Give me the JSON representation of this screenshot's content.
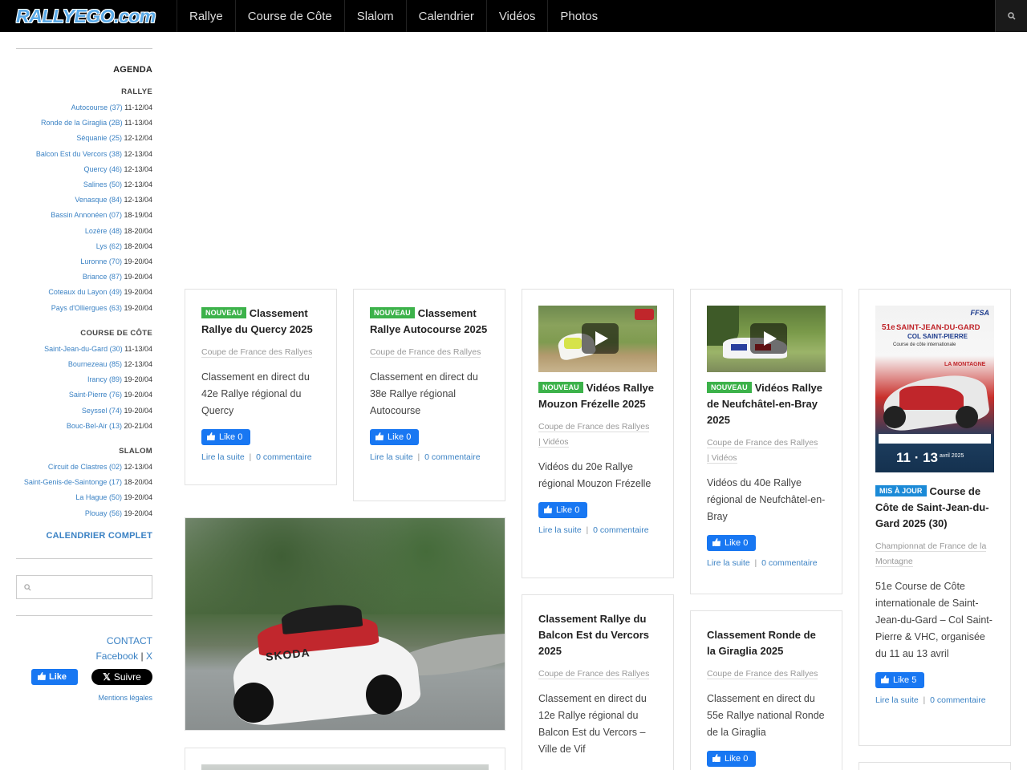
{
  "site": {
    "logo": "RALLYEGO.com"
  },
  "nav": [
    "Rallye",
    "Course de Côte",
    "Slalom",
    "Calendrier",
    "Vidéos",
    "Photos"
  ],
  "sidebar": {
    "agenda_title": "AGENDA",
    "categories": [
      {
        "title": "RALLYE",
        "events": [
          {
            "name": "Autocourse (37)",
            "dates": "11-12/04"
          },
          {
            "name": "Ronde de la Giraglia (2B)",
            "dates": "11-13/04"
          },
          {
            "name": "Séquanie (25)",
            "dates": "12-12/04"
          },
          {
            "name": "Balcon Est du Vercors (38)",
            "dates": "12-13/04"
          },
          {
            "name": "Quercy (46)",
            "dates": "12-13/04"
          },
          {
            "name": "Salines (50)",
            "dates": "12-13/04"
          },
          {
            "name": "Venasque (84)",
            "dates": "12-13/04"
          },
          {
            "name": "Bassin Annonéen (07)",
            "dates": "18-19/04"
          },
          {
            "name": "Lozère (48)",
            "dates": "18-20/04"
          },
          {
            "name": "Lys (62)",
            "dates": "18-20/04"
          },
          {
            "name": "Luronne (70)",
            "dates": "19-20/04"
          },
          {
            "name": "Briance (87)",
            "dates": "19-20/04"
          },
          {
            "name": "Coteaux du Layon (49)",
            "dates": "19-20/04"
          },
          {
            "name": "Pays d'Olliergues (63)",
            "dates": "19-20/04"
          }
        ]
      },
      {
        "title": "COURSE DE CÔTE",
        "events": [
          {
            "name": "Saint-Jean-du-Gard (30)",
            "dates": "11-13/04"
          },
          {
            "name": "Bournezeau (85)",
            "dates": "12-13/04"
          },
          {
            "name": "Irancy (89)",
            "dates": "19-20/04"
          },
          {
            "name": "Saint-Pierre (76)",
            "dates": "19-20/04"
          },
          {
            "name": "Seyssel (74)",
            "dates": "19-20/04"
          },
          {
            "name": "Bouc-Bel-Air (13)",
            "dates": "20-21/04"
          }
        ]
      },
      {
        "title": "SLALOM",
        "events": [
          {
            "name": "Circuit de Clastres (02)",
            "dates": "12-13/04"
          },
          {
            "name": "Saint-Genis-de-Saintonge (17)",
            "dates": "18-20/04"
          },
          {
            "name": "La Hague (50)",
            "dates": "19-20/04"
          },
          {
            "name": "Plouay (56)",
            "dates": "19-20/04"
          }
        ]
      }
    ],
    "calendar_full": "CALENDRIER COMPLET",
    "contact": "CONTACT",
    "facebook": "Facebook",
    "separator": "|",
    "x": "X",
    "fb_like": "Like",
    "x_follow": "Suivre",
    "legal": "Mentions légales"
  },
  "colors": {
    "link": "#3b82c4",
    "badge_new": "#3cb24a",
    "badge_update": "#1b8ad7",
    "facebook": "#1877f2"
  },
  "cards": {
    "c1": {
      "badge": "NOUVEAU",
      "title": "Classement Rallye du Quercy 2025",
      "category": "Coupe de France des Rallyes",
      "excerpt": "Classement en direct du 42e Rallye régional du Quercy",
      "likes": "Like 0",
      "more": "Lire la suite",
      "comments": "0 commentaire"
    },
    "c2": {
      "badge": "NOUVEAU",
      "title": "Classement Rallye Autocourse 2025",
      "category": "Coupe de France des Rallyes",
      "excerpt": "Classement en direct du 38e Rallye régional Autocourse",
      "likes": "Like 0",
      "more": "Lire la suite",
      "comments": "0 commentaire"
    },
    "c3": {
      "badge": "NOUVEAU",
      "title": "Vidéos Rallye Mouzon Frézelle 2025",
      "category": "Coupe de France des Rallyes",
      "category2": "| Vidéos",
      "excerpt": "Vidéos du 20e Rallye régional Mouzon Frézelle",
      "likes": "Like 0",
      "more": "Lire la suite",
      "comments": "0 commentaire"
    },
    "c4": {
      "badge": "NOUVEAU",
      "title": "Vidéos Rallye de Neufchâtel-en-Bray 2025",
      "category": "Coupe de France des Rallyes",
      "category2": "| Vidéos",
      "excerpt": "Vidéos du 40e Rallye régional de Neufchâtel-en-Bray",
      "likes": "Like 0",
      "more": "Lire la suite",
      "comments": "0 commentaire"
    },
    "c5": {
      "badge": "MIS À JOUR",
      "title": "Course de Côte de Saint-Jean-du-Gard 2025 (30)",
      "category": "Championnat de France de la Montagne",
      "excerpt": "51e Course de Côte internationale de Saint-Jean-du-Gard – Col Saint-Pierre & VHC, organisée du 11 au 13 avril",
      "likes": "Like 5",
      "more": "Lire la suite",
      "comments": "0 commentaire",
      "poster_line1": "SAINT-JEAN-DU-GARD",
      "poster_line2": "COL SAINT-PIERRE",
      "poster_dates": "11 · 13",
      "poster_brand": "FFSA",
      "poster_num": "51e",
      "poster_sub": "Course de côte internationale",
      "poster_mountain": "LA MONTAGNE",
      "poster_month": "avril 2025"
    },
    "c6": {
      "title": "Classement Rallye du Balcon Est du Vercors 2025",
      "category": "Coupe de France des Rallyes",
      "excerpt": "Classement en direct du 12e Rallye régional du Balcon Est du Vercors – Ville de Vif"
    },
    "c7": {
      "title": "Classement Ronde de la Giraglia 2025",
      "category": "Coupe de France des Rallyes",
      "excerpt": "Classement en direct du 55e Rallye national Ronde de la Giraglia",
      "likes": "Like 0"
    }
  },
  "photo_card": {
    "plate_text": "SKODA"
  }
}
